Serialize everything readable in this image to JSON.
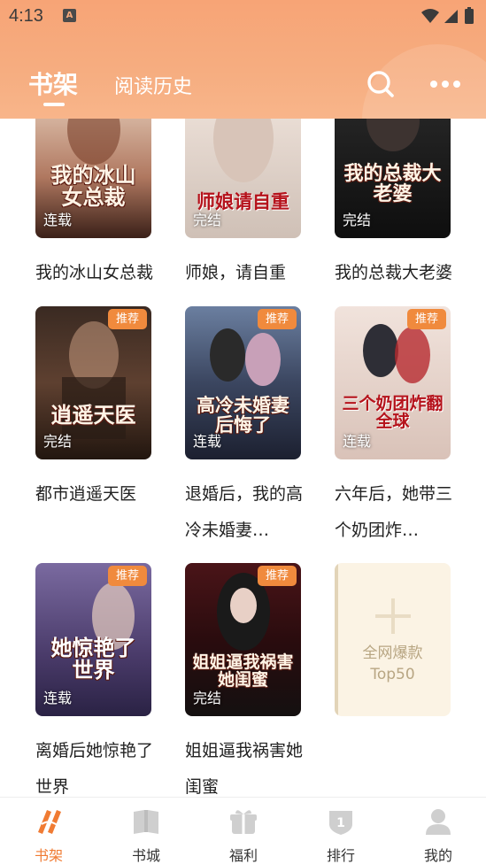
{
  "status_bar": {
    "time": "4:13",
    "notification_glyph": "A"
  },
  "header": {
    "tabs": [
      {
        "label": "书架",
        "active": true
      },
      {
        "label": "阅读历史",
        "active": false
      }
    ],
    "icons": [
      "search-icon",
      "more-icon"
    ]
  },
  "books": [
    {
      "title": "我的冰山女总裁",
      "cover_text": "我的冰山女总裁",
      "status": "连载",
      "badge": ""
    },
    {
      "title": "师娘，请自重",
      "cover_text": "师娘请自重",
      "status": "完结",
      "badge": ""
    },
    {
      "title": "我的总裁大老婆",
      "cover_text": "我的总裁大老婆",
      "status": "完结",
      "badge": ""
    },
    {
      "title": "都市逍遥天医",
      "cover_text": "逍遥天医",
      "status": "完结",
      "badge": "推荐"
    },
    {
      "title": "退婚后，我的高冷未婚妻…",
      "cover_text": "高冷未婚妻后悔了",
      "status": "连载",
      "badge": "推荐"
    },
    {
      "title": "六年后，她带三个奶团炸…",
      "cover_text": "三个奶团炸翻全球",
      "status": "连载",
      "badge": "推荐"
    },
    {
      "title": "离婚后她惊艳了世界",
      "cover_text": "她惊艳了世界",
      "status": "连载",
      "badge": "推荐"
    },
    {
      "title": "姐姐逼我祸害她闺蜜",
      "cover_text": "姐姐逼我祸害她闺蜜",
      "status": "完结",
      "badge": "推荐"
    }
  ],
  "add_card": {
    "line1": "全网爆款",
    "line2": "Top50"
  },
  "bottom_nav": [
    {
      "label": "书架",
      "icon": "bookshelf-icon",
      "active": true
    },
    {
      "label": "书城",
      "icon": "book-icon",
      "active": false
    },
    {
      "label": "福利",
      "icon": "gift-icon",
      "active": false
    },
    {
      "label": "排行",
      "icon": "rank-icon",
      "active": false
    },
    {
      "label": "我的",
      "icon": "profile-icon",
      "active": false
    }
  ],
  "colors": {
    "accent": "#f07b33",
    "header": "#f7a476",
    "badge": "#f08a3d",
    "text": "#222222"
  }
}
